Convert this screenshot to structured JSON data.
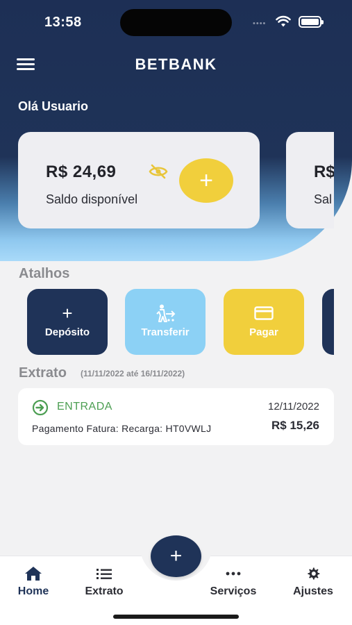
{
  "status_bar": {
    "time": "13:58",
    "signal": "••••"
  },
  "header": {
    "title": "BETBANK",
    "greeting": "Olá Usuario"
  },
  "balance_card": {
    "value": "R$ 24,69",
    "label": "Saldo disponível",
    "add_button": "+"
  },
  "next_card_peek": {
    "value": "R$",
    "label": "Sal"
  },
  "shortcuts": {
    "title": "Atalhos",
    "items": [
      {
        "label": "Depósito",
        "icon": "+"
      },
      {
        "label": "Transferir",
        "icon": "transfer-person-icon"
      },
      {
        "label": "Pagar",
        "icon": "card-icon"
      }
    ]
  },
  "statement": {
    "title": "Extrato",
    "range": "(11/11/2022 até 16/11/2022)",
    "transactions": [
      {
        "type": "ENTRADA",
        "date": "12/11/2022",
        "description": "Pagamento Fatura: Recarga: HT0VWLJ",
        "amount": "R$ 15,26"
      }
    ]
  },
  "tabbar": {
    "items": [
      {
        "label": "Home",
        "icon": "home-icon"
      },
      {
        "label": "Extrato",
        "icon": "list-icon"
      },
      {
        "label": "Serviços",
        "icon": "more-dots-icon"
      },
      {
        "label": "Ajustes",
        "icon": "gear-icon"
      }
    ],
    "fab": "+"
  },
  "colors": {
    "navy": "#1f3358",
    "yellow": "#f1cf3c",
    "light_blue": "#8cd1f5",
    "green": "#4c9e52"
  }
}
